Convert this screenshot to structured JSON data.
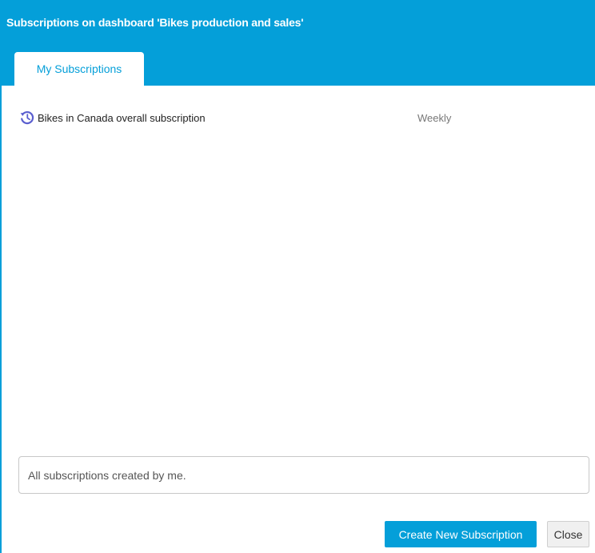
{
  "dialog": {
    "title": "Subscriptions on dashboard 'Bikes production and sales'"
  },
  "tabs": [
    {
      "label": "My Subscriptions",
      "active": true
    }
  ],
  "subscriptions": [
    {
      "name": "Bikes in Canada overall subscription",
      "frequency": "Weekly",
      "icon": "history-clock-icon"
    }
  ],
  "info": {
    "text": "All subscriptions created by me."
  },
  "footer": {
    "create_label": "Create New Subscription",
    "close_label": "Close"
  },
  "colors": {
    "accent": "#049fd9",
    "icon": "#5b5fcf"
  }
}
